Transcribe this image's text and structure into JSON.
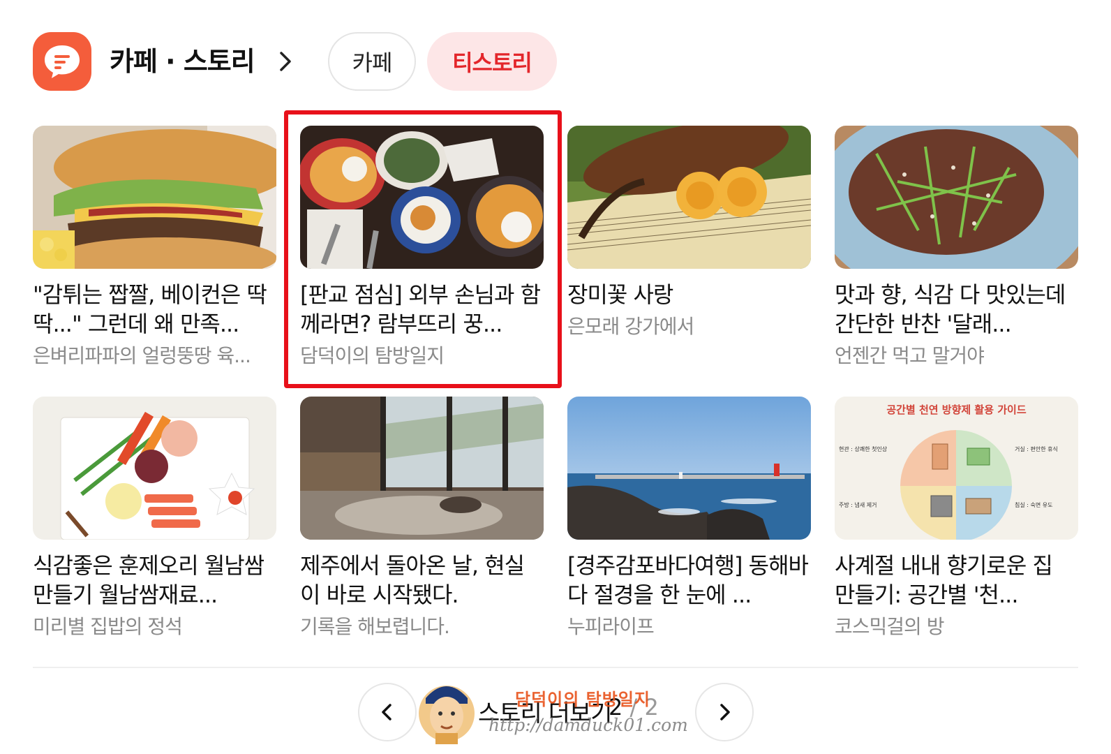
{
  "header": {
    "title": "카페 · 스토리",
    "logo_icon": "chat-bubble-icon",
    "tabs": [
      {
        "label": "카페",
        "active": false
      },
      {
        "label": "티스토리",
        "active": true
      }
    ],
    "accent_color": "#f45d3b",
    "active_tab_color": "#e3262b"
  },
  "cards": [
    {
      "title": "\"감튀는 짭짤, 베이컨은 딱딱...\" 그런데 왜 만족...",
      "source": "은벼리파파의 얼렁뚱땅 육...",
      "thumb": "burger"
    },
    {
      "title": "[판교 점심] 외부 손님과 함께라면? 람부뜨리 꿍...",
      "source": "담덕이의 탐방일지",
      "thumb": "thai-food",
      "highlighted": true
    },
    {
      "title": "장미꽃 사랑",
      "source": "은모래 강가에서",
      "thumb": "violin-roses"
    },
    {
      "title": "맛과 향, 식감 다 맛있는데 간단한 반찬 '달래...",
      "source": "언젠간 먹고 말거야",
      "thumb": "side-dish"
    },
    {
      "title": "식감좋은 훈제오리 월남쌈 만들기 월남쌈재료...",
      "source": "미리별 집밥의 정석",
      "thumb": "spring-rolls"
    },
    {
      "title": "제주에서 돌아온 날, 현실이 바로 시작됐다.",
      "source": "기록을 해보렵니다.",
      "thumb": "window-room"
    },
    {
      "title": "[경주감포바다여행] 동해바다 절경을 한 눈에 ...",
      "source": "누피라이프",
      "thumb": "sea-coast"
    },
    {
      "title": "사계절 내내 향기로운 집 만들기: 공간별 '천...",
      "source": "코스믹걸의 방",
      "thumb": "infographic"
    }
  ],
  "infographic": {
    "title": "공간별 천연 방향제 활용 가이드",
    "labels": [
      "현관 : 상쾌한 첫인상",
      "거실 : 편안한 휴식",
      "주방 : 냄새 제거",
      "침실 : 숙면 유도"
    ]
  },
  "pager": {
    "more_label": "스토리 더보기",
    "current": "2",
    "total": "/ 2",
    "prev_icon": "chevron-left-icon",
    "next_icon": "chevron-right-icon"
  },
  "watermark": {
    "name": "담덕이의 탐방일지",
    "url": "http://damduck01.com"
  }
}
